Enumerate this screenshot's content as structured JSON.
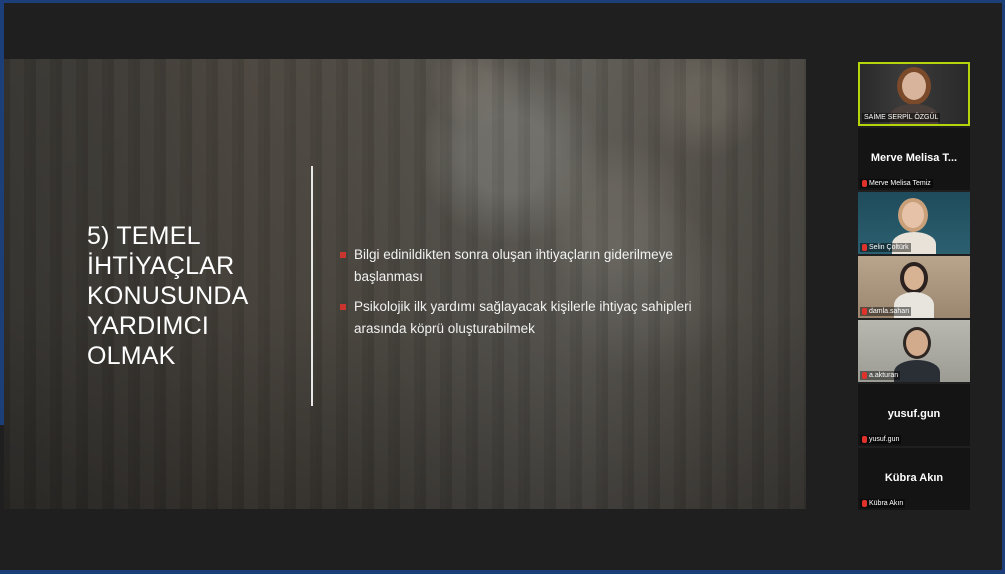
{
  "slide": {
    "title_lines": [
      "5) TEMEL",
      "İHTİYAÇLAR",
      "KONUSUNDA",
      "YARDIMCI",
      "OLMAK"
    ],
    "bullets": [
      "Bilgi edinildikten sonra oluşan ihtiyaçların giderilmeye başlanması",
      "Psikolojik ilk yardımı sağlayacak kişilerle ihtiyaç sahipleri arasında köprü oluşturabilmek"
    ]
  },
  "participants": [
    {
      "display": "",
      "label": "SAİME SERPİL ÖZGÜL",
      "video": true,
      "active": true
    },
    {
      "display": "Merve Melisa T...",
      "label": "Merve Melisa Temiz",
      "video": false,
      "muted": true
    },
    {
      "display": "",
      "label": "Selin Çoltürk",
      "video": true,
      "muted": true
    },
    {
      "display": "",
      "label": "damla.sahan",
      "video": true,
      "muted": true
    },
    {
      "display": "",
      "label": "a.akturan",
      "video": true,
      "muted": true
    },
    {
      "display": "yusuf.gun",
      "label": "yusuf.gun",
      "video": false,
      "muted": true
    },
    {
      "display": "Kübra Akın",
      "label": "Kübra Akın",
      "video": false,
      "muted": true
    }
  ],
  "colors": {
    "frame_accent": "#1c3f7a",
    "active_speaker_border": "#b5d40a",
    "bullet_accent": "#c9342f",
    "mic_muted": "#e0322b"
  },
  "icons": {
    "muted_mic": "mic-off-icon"
  }
}
